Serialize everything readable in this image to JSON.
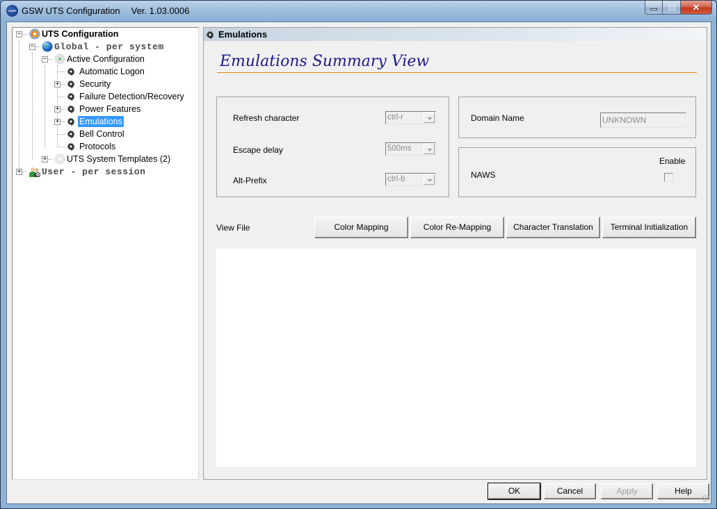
{
  "window": {
    "title": "GSW UTS Configuration",
    "version": "Ver. 1.03.0006",
    "icon": "gsw-globe-logo"
  },
  "tree": {
    "root": {
      "label": "UTS Configuration",
      "icon": "gear-globe-icon",
      "expanded": true
    },
    "global": {
      "label": "Global  - per system",
      "icon": "globe-icon",
      "expanded": true
    },
    "active_config": {
      "label": "Active Configuration",
      "icon": "active-gear-icon",
      "expanded": true
    },
    "items": [
      {
        "label": "Automatic Logon",
        "icon": "gear-icon",
        "expandable": false
      },
      {
        "label": "Security",
        "icon": "gear-icon",
        "expandable": true
      },
      {
        "label": "Failure Detection/Recovery",
        "icon": "gear-icon",
        "expandable": false
      },
      {
        "label": "Power Features",
        "icon": "gear-icon",
        "expandable": true
      },
      {
        "label": "Emulations",
        "icon": "gear-icon",
        "expandable": true,
        "selected": true
      },
      {
        "label": "Bell Control",
        "icon": "gear-icon",
        "expandable": false
      },
      {
        "label": "Protocols",
        "icon": "gear-icon",
        "expandable": false
      }
    ],
    "templates": {
      "label": "UTS System Templates (2)",
      "icon": "inactive-gear-icon",
      "expanded": false
    },
    "user": {
      "label": "User   - per session",
      "icon": "users-icon",
      "expanded": false
    }
  },
  "panel": {
    "header": "Emulations",
    "title": "Emulations Summary View",
    "fields": {
      "refresh_character": {
        "label": "Refresh character",
        "value": "ctrl-r"
      },
      "escape_delay": {
        "label": "Escape delay",
        "value": "500ms"
      },
      "alt_prefix": {
        "label": "Alt-Prefix",
        "value": "ctrl-b"
      }
    },
    "domain_name": {
      "label": "Domain Name",
      "value": "UNKNOWN"
    },
    "naws": {
      "label": "NAWS",
      "enable_label": "Enable",
      "checked": false
    },
    "view_file_label": "View File",
    "view_buttons": [
      "Color Mapping",
      "Color Re-Mapping",
      "Character Translation",
      "Terminal Initialization"
    ]
  },
  "dialog_buttons": {
    "ok": "OK",
    "cancel": "Cancel",
    "apply": "Apply",
    "help": "Help"
  },
  "colors": {
    "accent_title": "#1a1a8c",
    "rule": "#e8820e",
    "selection": "#3399ff"
  }
}
